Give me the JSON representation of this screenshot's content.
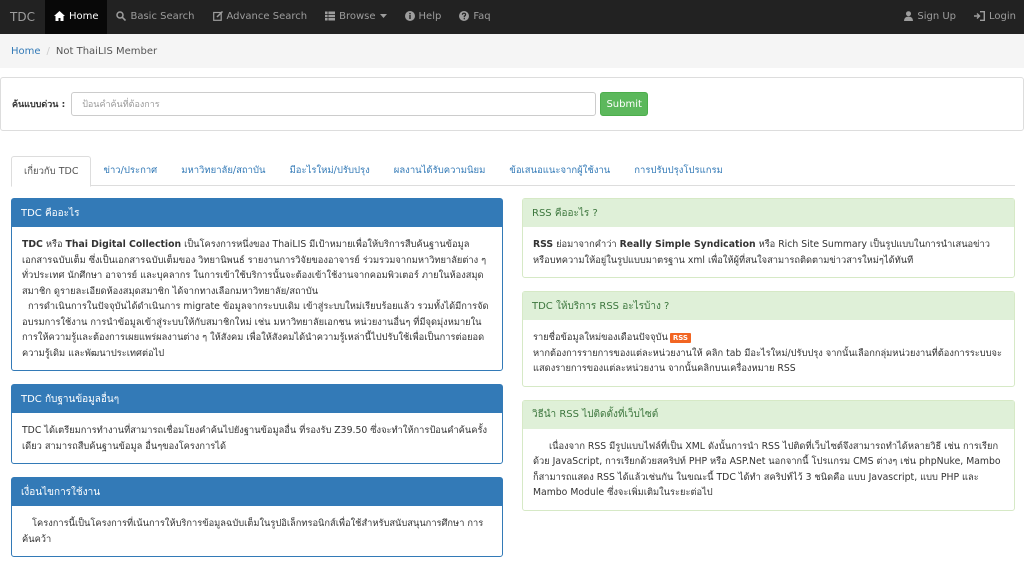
{
  "navbar": {
    "brand": "TDC",
    "items": [
      {
        "label": "Home"
      },
      {
        "label": "Basic Search"
      },
      {
        "label": "Advance Search"
      },
      {
        "label": "Browse"
      },
      {
        "label": "Help"
      },
      {
        "label": "Faq"
      }
    ],
    "right": [
      {
        "label": "Sign Up"
      },
      {
        "label": "Login"
      }
    ]
  },
  "breadcrumb": {
    "home": "Home",
    "separator": "/",
    "current": "Not ThaiLIS Member"
  },
  "search": {
    "label": "ค้นแบบด่วน :",
    "placeholder": "ป้อนคำค้นที่ต้องการ",
    "value": "",
    "submit_label": "Submit"
  },
  "tabs": [
    {
      "label": "เกี่ยวกับ TDC"
    },
    {
      "label": "ข่าว/ประกาศ"
    },
    {
      "label": "มหาวิทยาลัย/สถาบัน"
    },
    {
      "label": "มีอะไรใหม่/ปรับปรุง"
    },
    {
      "label": "ผลงานได้รับความนิยม"
    },
    {
      "label": "ข้อเสนอแนะจากผู้ใช้งาน"
    },
    {
      "label": "การปรับปรุงโปรแกรม"
    }
  ],
  "left_panels": [
    {
      "title": "TDC คืออะไร",
      "p1_b1": "TDC",
      "p1_t1": " หรือ ",
      "p1_b2": "Thai Digital Collection",
      "p1_t2": " เป็นโครงการหนึ่งของ ThaiLIS มีเป้าหมายเพื่อให้บริการสืบค้นฐานข้อมูลเอกสารฉบับเต็ม ซึ่งเป็นเอกสารฉบับเต็มของ วิทยานิพนธ์ รายงานการวิจัยของอาจารย์ ร่วมรวมจากมหาวิทยาลัยต่าง ๆ ทั่วประเทศ นักศึกษา อาจารย์ และบุคลากร ในการเข้าใช้บริการนั้นจะต้องเข้าใช้งานจากคอมพิวเตอร์ ภายในห้องสมุดสมาชิก ดูรายละเอียดห้องสมุดสมาชิก ได้จากทางเลือกมหาวิทยาลัย/สถาบัน",
      "p2": "การดำเนินการในปัจจุบันได้ดำเนินการ migrate ข้อมูลจากระบบเดิม เข้าสู่ระบบใหม่เรียบร้อยแล้ว รวมทั้งได้มีการจัดอบรมการใช้งาน การนำข้อมูลเข้าสู่ระบบให้กับสมาชิกใหม่ เช่น มหาวิทยาลัยเอกชน หน่วยงานอื่นๆ ที่มีจุดมุ่งหมายในการให้ความรู้และต้องการเผยแพร่ผลงานต่าง ๆ ให้สังคม เพื่อให้สังคมได้นำความรู้เหล่านี้ไปปรับใช้เพื่อเป็นการต่อยอดความรู้เดิม และพัฒนาประเทศต่อไป"
    },
    {
      "title": "TDC กับฐานข้อมูลอื่นๆ",
      "text": "TDC ได้เตรียมการทำงานที่สามารถเชื่อมโยงคำค้นไปยังฐานข้อมูลอื่น ที่รองรับ Z39.50 ซึ่งจะทำให้การป้อนคำค้นครั้งเดียว สามารถสืบค้นฐานข้อมูล อื่นๆของโครงการได้"
    },
    {
      "title": "เงื่อนไขการใช้งาน",
      "text": "โครงการนี้เป็นโครงการที่เน้นการให้บริการข้อมูลฉบับเต็มในรูปอิเล็กทรอนิกส์เพื่อใช้สำหรับสนับสนุนการศึกษา การค้นคว้า"
    }
  ],
  "right_panels": [
    {
      "title": "RSS คืออะไร ?",
      "b1": "RSS",
      "t1": " ย่อมาจากคำว่า ",
      "b2": "Really Simple Syndication",
      "t2": " หรือ Rich Site Summary เป็นรูปแบบในการนำเสนอข่าวหรือบทความให้อยู่ในรูปแบบมาตรฐาน xml เพื่อให้ผู้ที่สนใจสามารถติดตามข่าวสารใหม่ๆได้ทันที"
    },
    {
      "title": "TDC ให้บริการ RSS อะไรบ้าง ?",
      "line1": "รายชื่อข้อมูลใหม่ของเดือนปัจจุบัน",
      "badge": "RSS",
      "text": "หากต้องการรายการของแต่ละหน่วยงานให้ คลิก tab มีอะไรใหม่/ปรับปรุง จากนั้นเลือกกลุ่มหน่วยงานที่ต้องการระบบจะแสดงรายการของแต่ละหน่วยงาน จากนั้นคลิกบนเครื่องหมาย RSS"
    },
    {
      "title": "วิธีนำ RSS ไปติดตั้งที่เว็บไซต์",
      "text": "เนื่องจาก RSS มีรูปแบบไฟล์ที่เป็น XML ดังนั้นการนำ RSS ไปติดที่เว็บไซต์จึงสามารถทำได้หลายวิธี เช่น การเรียกด้วย JavaScript, การเรียกด้วยสคริปท์ PHP หรือ ASP.Net นอกจากนี้ โปรแกรม CMS ต่างๆ เช่น phpNuke, Mambo ก็สามารถแสดง RSS ได้แล้วเช่นกัน ในขณะนี้ TDC ได้ทำ สคริปท์ไว้ 3 ชนิดคือ แบบ Javascript, แบบ PHP และ Mambo Module ซึ่งจะเพิ่มเติมในระยะต่อไป"
    }
  ]
}
